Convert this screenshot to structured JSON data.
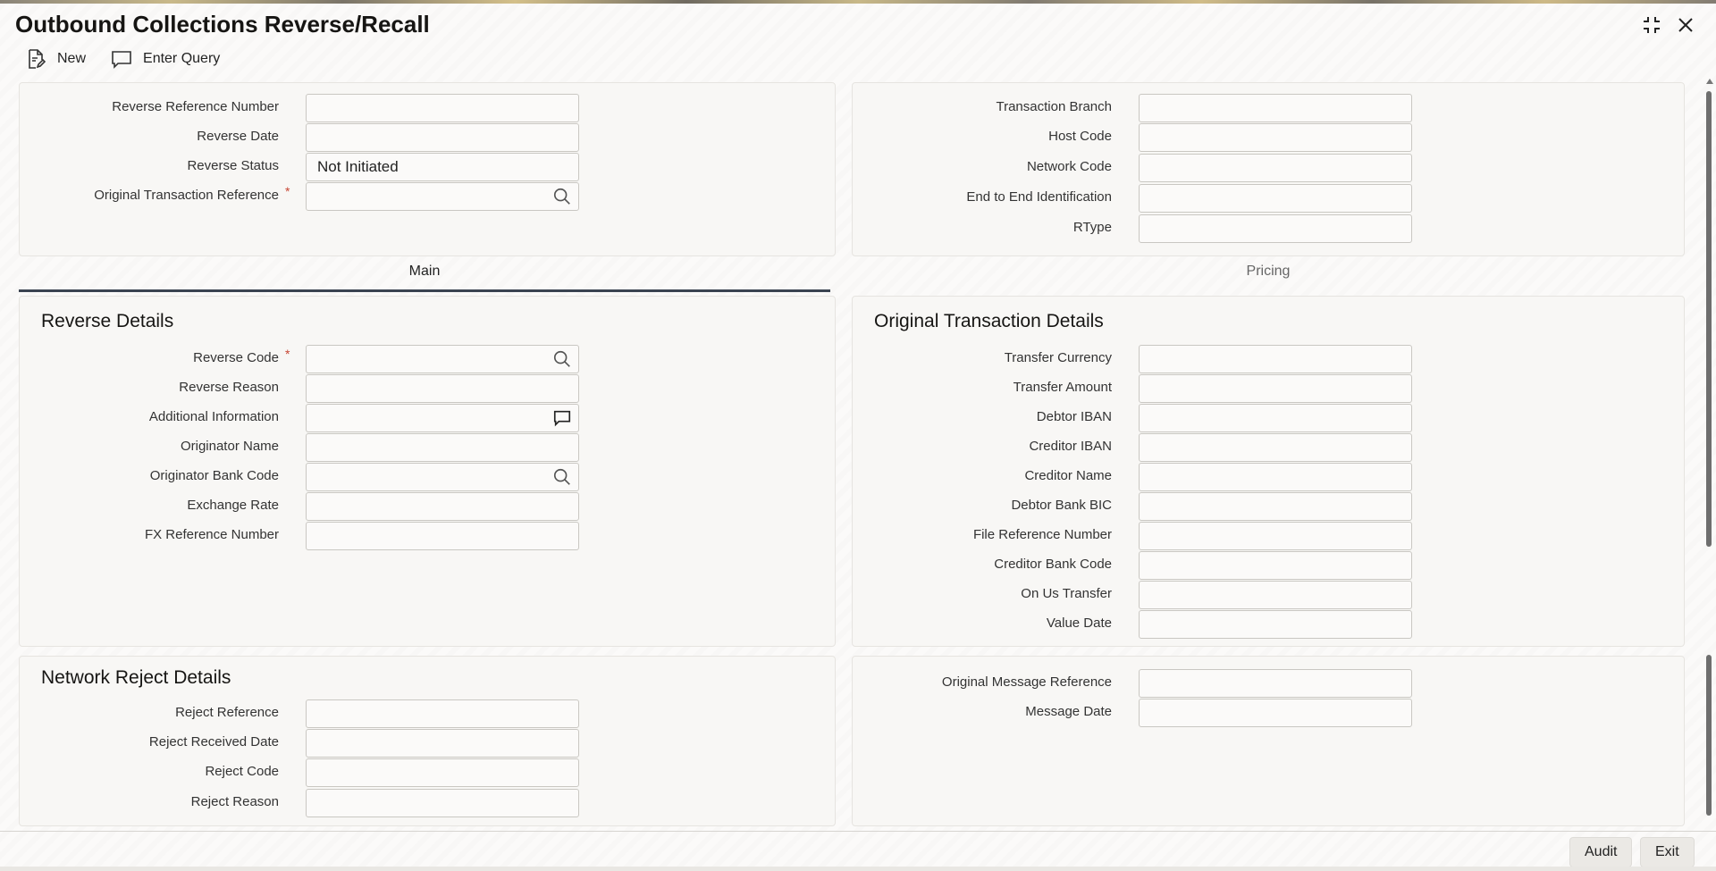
{
  "window": {
    "title": "Outbound Collections Reverse/Recall",
    "icons": [
      "minimize-icon",
      "close-icon"
    ]
  },
  "toolbar": {
    "new_label": "New",
    "enter_query_label": "Enter Query"
  },
  "header_left": {
    "reverse_reference_number": {
      "label": "Reverse Reference Number",
      "value": ""
    },
    "reverse_date": {
      "label": "Reverse Date",
      "value": ""
    },
    "reverse_status": {
      "label": "Reverse Status",
      "value": "Not Initiated"
    },
    "original_transaction_reference": {
      "label": "Original Transaction Reference",
      "value": "",
      "required": true
    }
  },
  "header_right": {
    "transaction_branch": {
      "label": "Transaction Branch",
      "value": ""
    },
    "host_code": {
      "label": "Host Code",
      "value": ""
    },
    "network_code": {
      "label": "Network Code",
      "value": ""
    },
    "end_to_end_identification": {
      "label": "End to End Identification",
      "value": ""
    },
    "rtype": {
      "label": "RType",
      "value": ""
    }
  },
  "tabs": [
    {
      "label": "Main",
      "active": true
    },
    {
      "label": "Pricing",
      "active": false
    }
  ],
  "reverse_details": {
    "title": "Reverse Details",
    "reverse_code": {
      "label": "Reverse Code",
      "value": "",
      "required": true
    },
    "reverse_reason": {
      "label": "Reverse Reason",
      "value": ""
    },
    "additional_information": {
      "label": "Additional Information",
      "value": ""
    },
    "originator_name": {
      "label": "Originator Name",
      "value": ""
    },
    "originator_bank_code": {
      "label": "Originator Bank Code",
      "value": ""
    },
    "exchange_rate": {
      "label": "Exchange Rate",
      "value": ""
    },
    "fx_reference_number": {
      "label": "FX Reference Number",
      "value": ""
    }
  },
  "original_transaction_details": {
    "title": "Original Transaction Details",
    "transfer_currency": {
      "label": "Transfer Currency",
      "value": ""
    },
    "transfer_amount": {
      "label": "Transfer Amount",
      "value": ""
    },
    "debtor_iban": {
      "label": "Debtor IBAN",
      "value": ""
    },
    "creditor_iban": {
      "label": "Creditor IBAN",
      "value": ""
    },
    "creditor_name": {
      "label": "Creditor Name",
      "value": ""
    },
    "debtor_bank_bic": {
      "label": "Debtor Bank BIC",
      "value": ""
    },
    "file_reference_number": {
      "label": "File Reference Number",
      "value": ""
    },
    "creditor_bank_code": {
      "label": "Creditor Bank Code",
      "value": ""
    },
    "on_us_transfer": {
      "label": "On Us Transfer",
      "value": ""
    },
    "value_date": {
      "label": "Value Date",
      "value": ""
    }
  },
  "network_reject_details": {
    "title": "Network Reject Details",
    "reject_reference": {
      "label": "Reject Reference",
      "value": ""
    },
    "reject_received_date": {
      "label": "Reject Received Date",
      "value": ""
    },
    "reject_code": {
      "label": "Reject Code",
      "value": ""
    },
    "reject_reason": {
      "label": "Reject Reason",
      "value": ""
    }
  },
  "message_details": {
    "original_message_reference": {
      "label": "Original Message Reference",
      "value": ""
    },
    "message_date": {
      "label": "Message Date",
      "value": ""
    }
  },
  "footer": {
    "audit_label": "Audit",
    "exit_label": "Exit"
  },
  "colors": {
    "required_star": "#c74634",
    "active_tab_underline": "#3a4350",
    "panel_bg": "#f8f7f5"
  }
}
